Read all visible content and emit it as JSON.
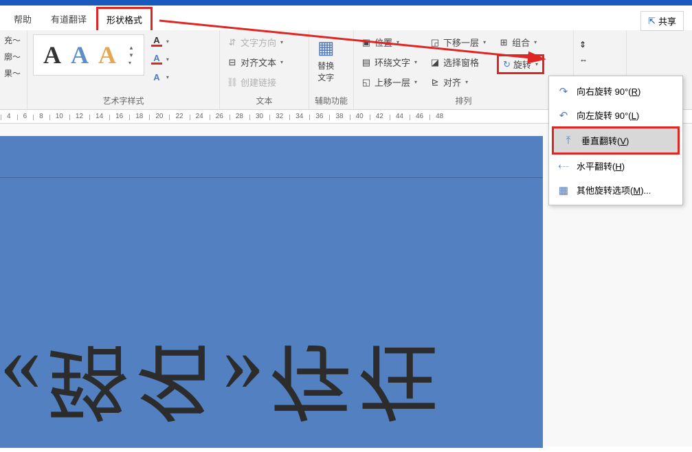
{
  "share_label": "共享",
  "tabs": {
    "help": "帮助",
    "translate": "有道翻译",
    "shape_format": "形状格式"
  },
  "collapsed": {
    "fill": "充～",
    "outline": "廓～",
    "effect": "果～"
  },
  "groups": {
    "wordart_styles": "艺术字样式",
    "text": "文本",
    "accessibility": "辅助功能",
    "arrange": "排列"
  },
  "text_group": {
    "direction": "文字方向",
    "align": "对齐文本",
    "link": "创建链接"
  },
  "accessibility": {
    "alt_text": "替换\n文字"
  },
  "arrange": {
    "position": "位置",
    "wrap": "环绕文字",
    "forward": "上移一层",
    "backward": "下移一层",
    "select_pane": "选择窗格",
    "align": "对齐",
    "group": "组合",
    "rotate": "旋转"
  },
  "rotate_menu": {
    "right90": "向右旋转 90°(",
    "right90_k": "R",
    "right90_s": ")",
    "left90": "向左旋转 90°(",
    "left90_k": "L",
    "left90_s": ")",
    "flipv": "垂直翻转(",
    "flipv_k": "V",
    "flipv_s": ")",
    "fliph": "水平翻转(",
    "fliph_k": "H",
    "fliph_s": ")",
    "more": "其他旋转选项(",
    "more_k": "M",
    "more_s": ")..."
  },
  "ruler_ticks": [
    "4",
    "6",
    "8",
    "10",
    "12",
    "14",
    "16",
    "18",
    "20",
    "22",
    "24",
    "26",
    "28",
    "30",
    "32",
    "34",
    "36",
    "38",
    "40",
    "42",
    "44",
    "46",
    "48"
  ],
  "canvas_text": "《臵名》存在"
}
